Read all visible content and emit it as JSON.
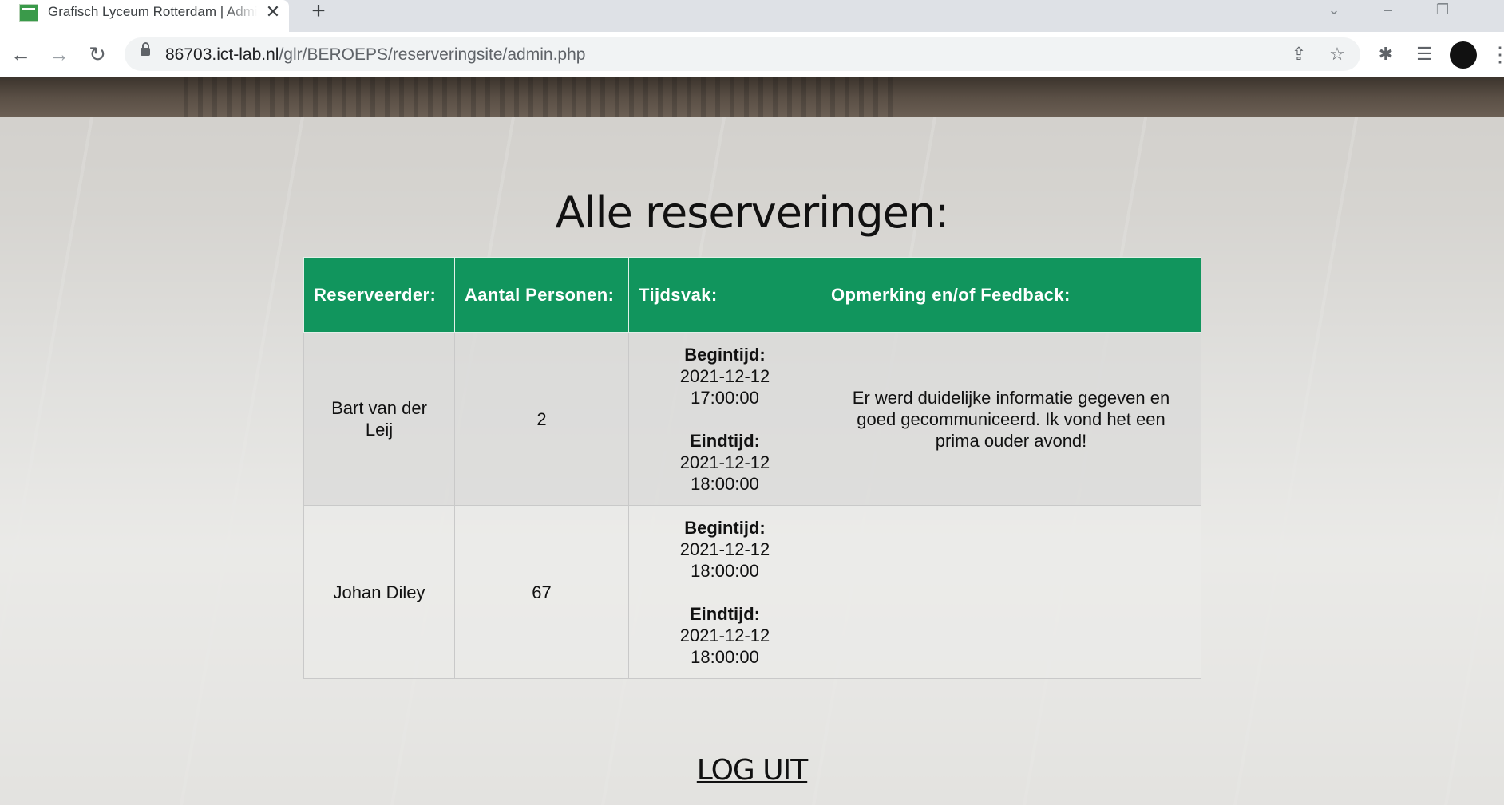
{
  "browser": {
    "tab_title": "Grafisch Lyceum Rotterdam | Admin",
    "tab_close": "✕",
    "new_tab": "+",
    "url_host": "86703.ict-lab.nl",
    "url_path": "/glr/BEROEPS/reserveringsite/admin.php",
    "icons": [
      "back-icon",
      "forward-icon",
      "reload-icon",
      "lock-icon",
      "share-icon",
      "star-icon",
      "extensions-icon",
      "reading-list-icon",
      "profile-avatar",
      "menu-icon"
    ]
  },
  "page": {
    "heading": "Alle reserveringen:",
    "columns": [
      "Reserveerder:",
      "Aantal Personen:",
      "Tijdsvak:",
      "Opmerking en/of Feedback:"
    ],
    "begin_label": "Begintijd:",
    "end_label": "Eindtijd:",
    "rows": [
      {
        "name": "Bart van der Leij",
        "persons": "2",
        "begin_date": "2021-12-12",
        "begin_time": "17:00:00",
        "end_date": "2021-12-12",
        "end_time": "18:00:00",
        "feedback": "Er werd duidelijke informatie gegeven en goed gecommuniceerd. Ik vond het een prima ouder avond!"
      },
      {
        "name": "Johan Diley",
        "persons": "67",
        "begin_date": "2021-12-12",
        "begin_time": "18:00:00",
        "end_date": "2021-12-12",
        "end_time": "18:00:00",
        "feedback": ""
      }
    ],
    "logout": "LOG UIT"
  },
  "colors": {
    "header_green": "#11955d",
    "text": "#111111"
  }
}
